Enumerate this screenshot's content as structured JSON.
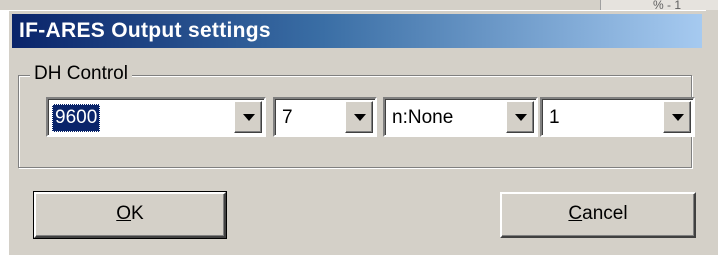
{
  "window": {
    "title": "IF-ARES Output settings",
    "background_fragment": "% - 1"
  },
  "group": {
    "label": "DH Control"
  },
  "combos": [
    {
      "value": "9600",
      "selected": true
    },
    {
      "value": "7",
      "selected": false
    },
    {
      "value": "n:None",
      "selected": false
    },
    {
      "value": "1",
      "selected": false
    }
  ],
  "buttons": {
    "ok": {
      "mnemonic": "O",
      "rest": "K"
    },
    "cancel": {
      "mnemonic": "C",
      "rest": "ancel"
    }
  },
  "colors": {
    "title_start": "#0a246a",
    "title_end": "#a6caf0",
    "face": "#d4d0c8",
    "selection": "#0a246a"
  },
  "icons": [
    "dropdown-arrow-icon"
  ]
}
